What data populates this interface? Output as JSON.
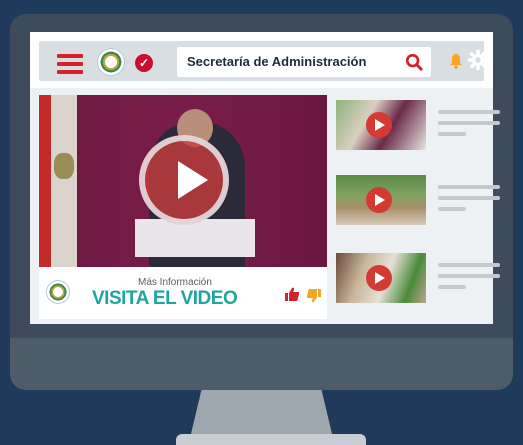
{
  "header": {
    "search_value": "Secretaría de Administración",
    "icons": [
      "hamburger-menu-icon",
      "government-seal-icon",
      "verified-check-icon",
      "search-icon",
      "bell-icon",
      "gear-icon"
    ]
  },
  "main_video": {
    "caption_small": "Más Información",
    "caption_cta": "VISITA EL VIDEO",
    "icons": [
      "play-icon",
      "thumbs-up-icon",
      "thumbs-down-icon"
    ]
  },
  "sidebar": {
    "items": [
      {
        "thumb": "video-thumbnail-1"
      },
      {
        "thumb": "video-thumbnail-2"
      },
      {
        "thumb": "video-thumbnail-3"
      }
    ]
  },
  "colors": {
    "background": "#1f3a5a",
    "accent_red": "#d2232a",
    "cta_teal": "#1fa5a0",
    "notification": "#f5a623"
  }
}
